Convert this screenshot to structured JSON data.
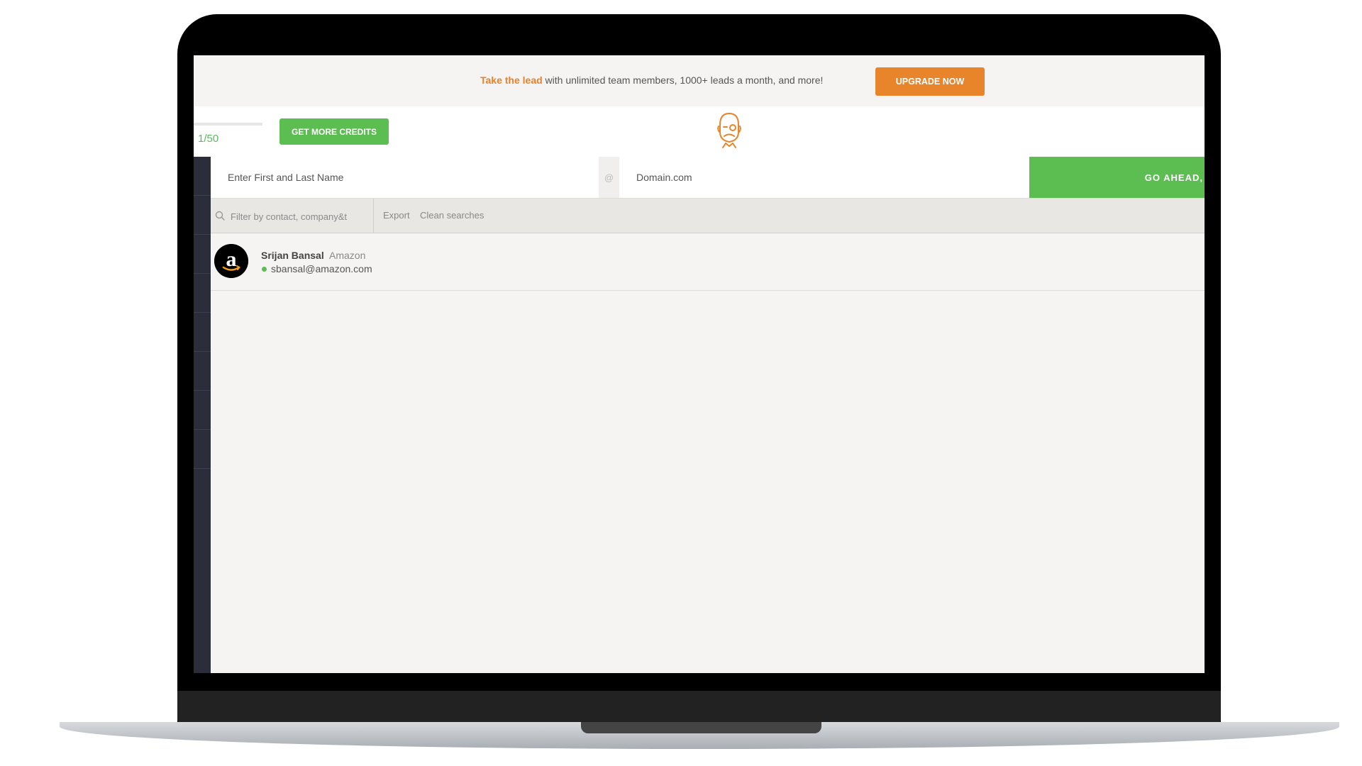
{
  "banner": {
    "lead_text": "Take the lead",
    "rest_text": " with unlimited team members, 1000+ leads a month, and more!",
    "upgrade_label": "UPGRADE NOW"
  },
  "topbar": {
    "credits_text": "1/50",
    "credits_used_fraction": 0.02,
    "get_more_credits_label": "GET MORE CREDITS",
    "logo_icon": "mascot-face-icon"
  },
  "search": {
    "name_placeholder": "Enter First and Last Name",
    "at_symbol": "@",
    "domain_placeholder": "Domain.com",
    "go_label": "GO AHEAD,"
  },
  "filter": {
    "placeholder": "Filter by contact, company&t",
    "export_label": "Export",
    "clean_label": "Clean searches",
    "icon": "search-icon"
  },
  "results": [
    {
      "name": "Srijan Bansal",
      "company": "Amazon",
      "email": "sbansal@amazon.com",
      "status_color": "#5cbd50",
      "avatar_icon": "amazon-logo-icon"
    }
  ],
  "colors": {
    "accent_orange": "#e8842a",
    "accent_green": "#5cbd50",
    "sidebar": "#2c2d3a"
  }
}
